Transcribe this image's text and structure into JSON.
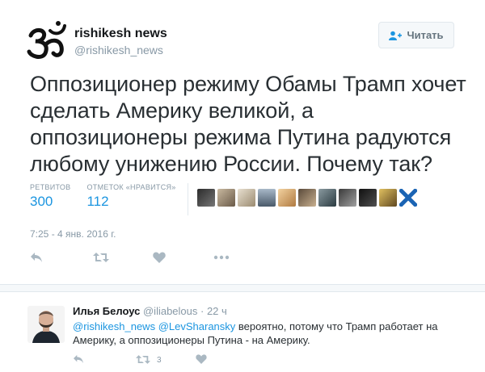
{
  "tweet": {
    "author_name": "rishikesh news",
    "author_handle": "@rishikesh_news",
    "follow_label": "Читать",
    "text": "Оппозиционер режиму Обамы Трамп хочет сделать Америку великой, а оппозиционеры режима Путина радуются любому унижению России. Почему так?",
    "stats": {
      "retweets_label": "РЕТВИТОВ",
      "retweets_value": "300",
      "likes_label": "ОТМЕТОК «НРАВИТСЯ»",
      "likes_value": "112"
    },
    "timestamp": "7:25 - 4 янв. 2016 г.",
    "colors": {
      "accent": "#1b95e0",
      "muted": "#8899a6",
      "text": "#292f33"
    }
  },
  "reply": {
    "author_name": "Илья Белоус",
    "author_handle": "@iliabelous",
    "time": "· 22 ч",
    "mention1": "@rishikesh_news",
    "mention2": "@LevSharansky",
    "text_line": " вероятно, потому что Трамп работает на Америку, а оппозиционеры Путина - на Америку.",
    "retweet_count": "3"
  }
}
